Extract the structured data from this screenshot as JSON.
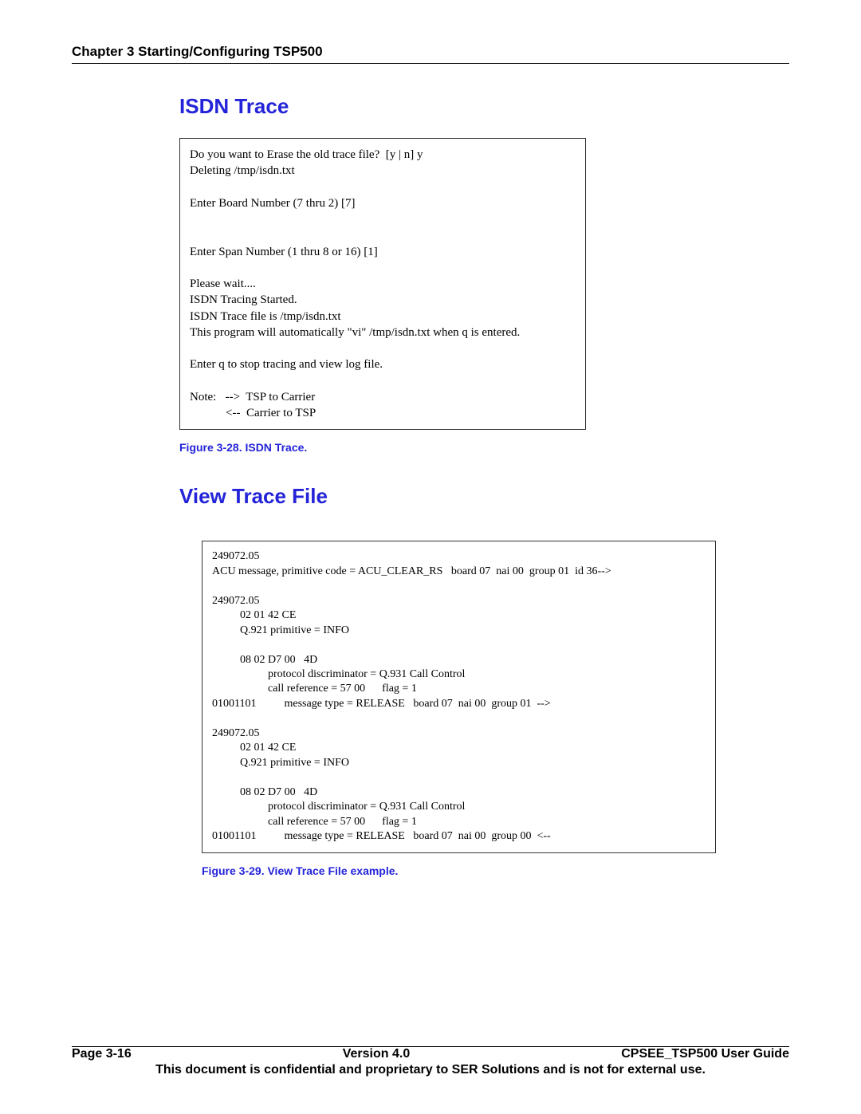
{
  "header": {
    "chapter": "Chapter 3 Starting/Configuring TSP500"
  },
  "section1": {
    "title": "ISDN Trace",
    "code": "Do you want to Erase the old trace file?  [y | n] y\nDeleting /tmp/isdn.txt\n\nEnter Board Number (7 thru 2) [7]\n\n\nEnter Span Number (1 thru 8 or 16) [1]\n\nPlease wait....\nISDN Tracing Started.\nISDN Trace file is /tmp/isdn.txt\nThis program will automatically \"vi\" /tmp/isdn.txt when q is entered.\n\nEnter q to stop tracing and view log file.\n\nNote:   -->  TSP to Carrier\n            <--  Carrier to TSP",
    "caption": "Figure 3-28. ISDN Trace."
  },
  "section2": {
    "title": "View Trace File",
    "code": "249072.05\nACU message, primitive code = ACU_CLEAR_RS   board 07  nai 00  group 01  id 36-->\n\n249072.05\n          02 01 42 CE\n          Q.921 primitive = INFO\n\n          08 02 D7 00   4D\n                    protocol discriminator = Q.931 Call Control\n                    call reference = 57 00      flag = 1\n01001101          message type = RELEASE   board 07  nai 00  group 01  -->\n\n249072.05\n          02 01 42 CE\n          Q.921 primitive = INFO\n\n          08 02 D7 00   4D\n                    protocol discriminator = Q.931 Call Control\n                    call reference = 57 00      flag = 1\n01001101          message type = RELEASE   board 07  nai 00  group 00  <--",
    "caption": "Figure 3-29. View Trace File example."
  },
  "footer": {
    "left": "Page 3-16",
    "center": "Version 4.0",
    "right": "CPSEE_TSP500 User Guide",
    "note": "This document is confidential and proprietary to SER Solutions and is not for external use."
  }
}
